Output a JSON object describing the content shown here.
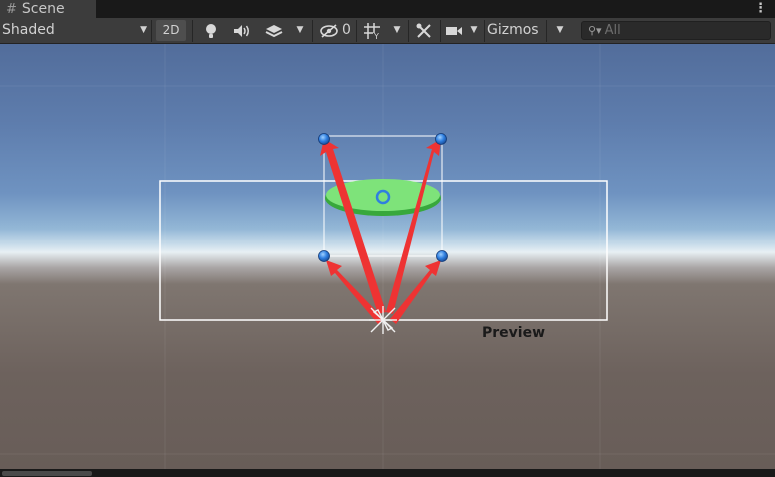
{
  "tab": {
    "icon": "grid-icon",
    "label": "Scene",
    "menu_icon": "more-vertical-icon"
  },
  "toolbar": {
    "draw_mode": "Shaded",
    "mode_2d": "2D",
    "lighting_icon": "lightbulb-icon",
    "audio_icon": "speaker-icon",
    "effects_icon": "layers-icon",
    "hidden_icon": "eye-slash-icon",
    "hidden_count": "0",
    "grid_icon": "grid-snap-icon",
    "tools_icon": "tools-icon",
    "camera_icon": "camera-icon",
    "gizmos_label": "Gizmos",
    "search_placeholder": "All"
  },
  "scene": {
    "preview_label": "Preview",
    "accent_colors": {
      "arrow": "#ee3333",
      "handle": "#2f7fe0",
      "platform": "#7ee37a",
      "platform_edge": "#38a83c"
    }
  }
}
